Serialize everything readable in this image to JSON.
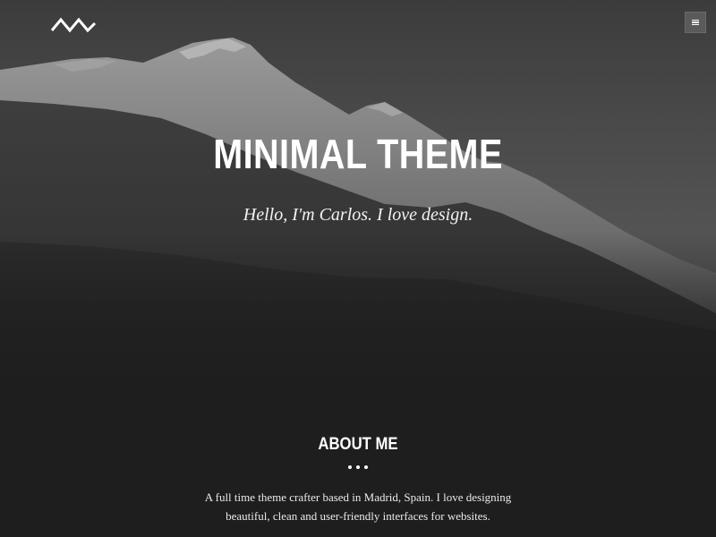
{
  "header": {
    "logo_icon": "mountain-logo-icon",
    "menu_icon": "hamburger-menu-icon"
  },
  "hero": {
    "title": "MINIMAL THEME",
    "tagline": "Hello, I'm Carlos. I love design."
  },
  "about": {
    "heading": "ABOUT ME",
    "divider_icon": "three-dots-icon",
    "text_line_1": "A full time theme crafter based in Madrid, Spain. I love designing",
    "text_line_2": "beautiful, clean and user-friendly interfaces for websites."
  },
  "colors": {
    "background": "#1e1e1e",
    "text": "#ffffff",
    "menu_button": "#5a5a5a"
  }
}
